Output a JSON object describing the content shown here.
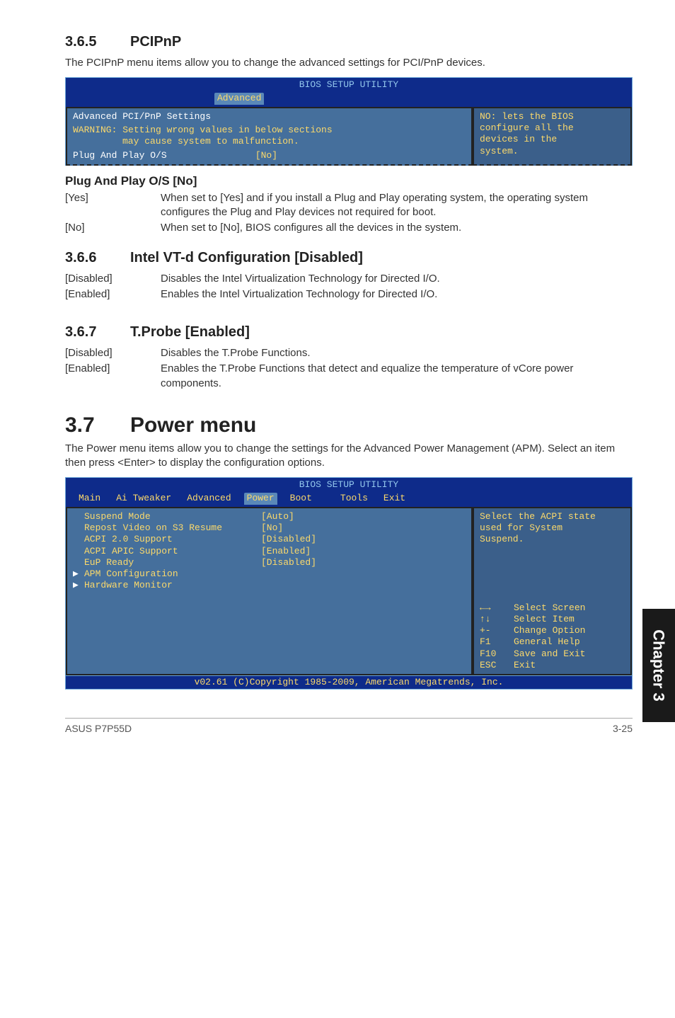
{
  "side_tab": "Chapter 3",
  "s365": {
    "num": "3.6.5",
    "title": "PCIPnP",
    "intro": "The PCIPnP menu items allow you to change the advanced settings for PCI/PnP devices.",
    "bios": {
      "title": "BIOS SETUP UTILITY",
      "tab": "Advanced",
      "heading": "Advanced PCI/PnP Settings",
      "warning_l1": "WARNING: Setting wrong values in below sections",
      "warning_l2": "may cause system to malfunction.",
      "item_label": "Plug And Play O/S",
      "item_value": "[No]",
      "help_l1": "NO: lets the BIOS",
      "help_l2": "configure all the",
      "help_l3": "devices in the",
      "help_l4": "system."
    },
    "sub": "Plug And Play O/S [No]",
    "rows": [
      {
        "label": "[Yes]",
        "value": "When set to [Yes] and if you install a Plug and Play operating system, the operating system configures the Plug and Play devices not required for boot."
      },
      {
        "label": "[No]",
        "value": "When set to [No], BIOS configures all the devices in the system."
      }
    ]
  },
  "s366": {
    "num": "3.6.6",
    "title": "Intel VT-d Configuration [Disabled]",
    "rows": [
      {
        "label": "[Disabled]",
        "value": "Disables the Intel Virtualization Technology for Directed I/O."
      },
      {
        "label": "[Enabled]",
        "value": "Enables the Intel Virtualization Technology for Directed I/O."
      }
    ]
  },
  "s367": {
    "num": "3.6.7",
    "title": "T.Probe [Enabled]",
    "rows": [
      {
        "label": "[Disabled]",
        "value": "Disables the T.Probe Functions."
      },
      {
        "label": "[Enabled]",
        "value": "Enables the T.Probe Functions that detect and equalize the temperature of vCore power components."
      }
    ]
  },
  "s37": {
    "num": "3.7",
    "title": "Power menu",
    "intro": "The Power menu items allow you to change the settings for the Advanced Power Management (APM). Select an item then press <Enter> to display the configuration options.",
    "bios": {
      "title": "BIOS SETUP UTILITY",
      "tabs": [
        "Main",
        "Ai Tweaker",
        "Advanced",
        "Power",
        "Boot",
        "Tools",
        "Exit"
      ],
      "active_tab": "Power",
      "items": [
        {
          "label": "Suspend Mode",
          "value": "[Auto]"
        },
        {
          "label": "Repost Video on S3 Resume",
          "value": "[No]"
        },
        {
          "label": "ACPI 2.0 Support",
          "value": "[Disabled]"
        },
        {
          "label": "ACPI APIC Support",
          "value": "[Enabled]"
        },
        {
          "label": "EuP Ready",
          "value": "[Disabled]"
        }
      ],
      "subitems": [
        "APM Configuration",
        "Hardware Monitor"
      ],
      "help_top": [
        "Select the ACPI state",
        "used for System",
        "Suspend."
      ],
      "keys": [
        {
          "k": "←→",
          "d": "Select Screen"
        },
        {
          "k": "↑↓",
          "d": "Select Item"
        },
        {
          "k": "+-",
          "d": "Change Option"
        },
        {
          "k": "F1",
          "d": "General Help"
        },
        {
          "k": "F10",
          "d": "Save and Exit"
        },
        {
          "k": "ESC",
          "d": "Exit"
        }
      ],
      "footer": "v02.61 (C)Copyright 1985-2009, American Megatrends, Inc."
    }
  },
  "footer": {
    "left": "ASUS P7P55D",
    "right": "3-25"
  }
}
